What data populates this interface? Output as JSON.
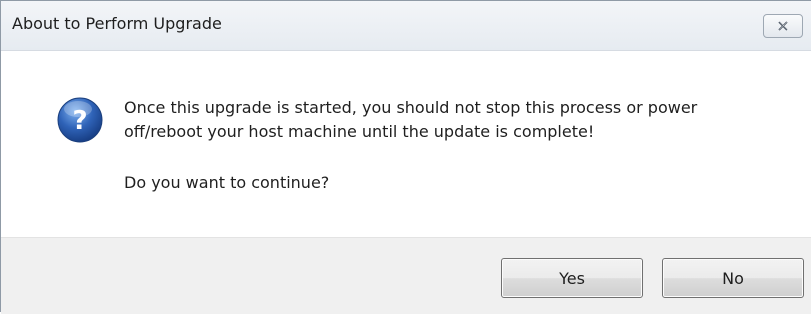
{
  "window": {
    "title": "About to Perform Upgrade",
    "close_icon": "close-icon"
  },
  "message": {
    "icon": "question-icon",
    "line1": "Once this upgrade is started, you should not stop this process or power",
    "line2": "off/reboot your host machine until the update is complete!",
    "question": "Do you want to continue?"
  },
  "buttons": {
    "yes_label": "Yes",
    "no_label": "No"
  },
  "colors": {
    "icon_blue": "#2f63b8",
    "footer_bg": "#f0f0f0",
    "titlebar_bg": "#e9edf2"
  }
}
